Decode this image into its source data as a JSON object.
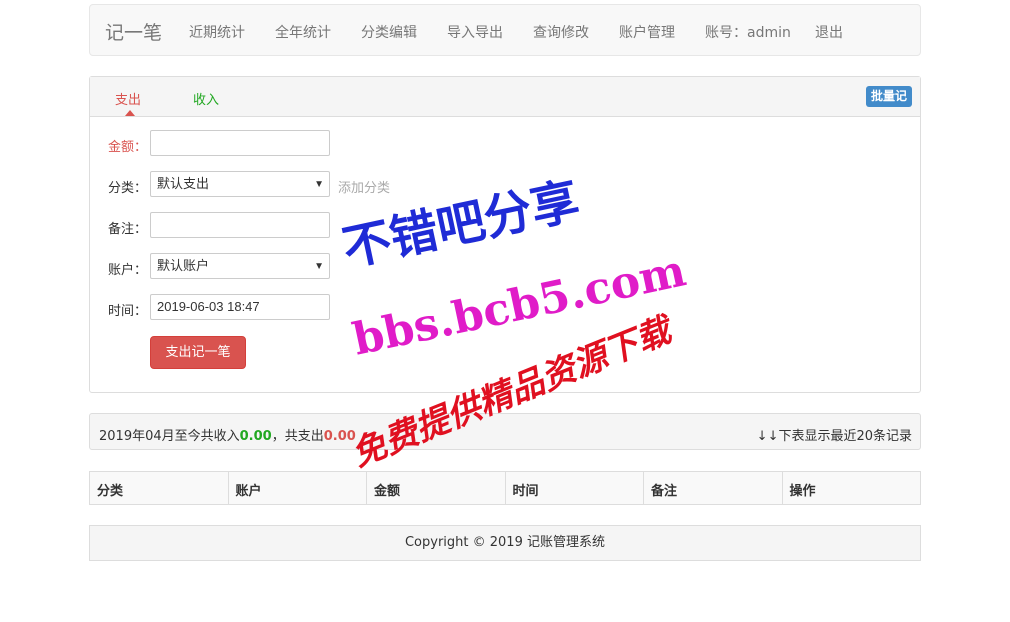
{
  "navbar": {
    "brand": "记一笔",
    "items": [
      "近期统计",
      "全年统计",
      "分类编辑",
      "导入导出",
      "查询修改",
      "账户管理",
      "账号：admin",
      "退出"
    ]
  },
  "entry": {
    "tabs": {
      "expense": "支出",
      "income": "收入"
    },
    "batch_label": "批量记",
    "labels": {
      "amount": "金额：",
      "category": "分类：",
      "note": "备注：",
      "account": "账户：",
      "time": "时间："
    },
    "values": {
      "amount": "",
      "category": "默认支出",
      "note": "",
      "account": "默认账户",
      "time": "2019-06-03 18:47"
    },
    "add_category": "添加分类",
    "submit": "支出记一笔"
  },
  "summary": {
    "prefix": "2019年04月至今共收入",
    "income": "0.00",
    "middle": "，共支出",
    "expense": "0.00",
    "right": "↓↓下表显示最近20条记录"
  },
  "table": {
    "columns": [
      "分类",
      "账户",
      "金额",
      "时间",
      "备注",
      "操作"
    ]
  },
  "footer": {
    "text": "Copyright © 2019 记账管理系统"
  },
  "watermark": {
    "line1": "不错吧分享",
    "line2": "bbs.bcb5.com",
    "line3": "免费提供精品资源下载"
  },
  "colors": {
    "expense_red": "#d9534f",
    "income_green": "#22a822",
    "batch_blue": "#428bca"
  }
}
